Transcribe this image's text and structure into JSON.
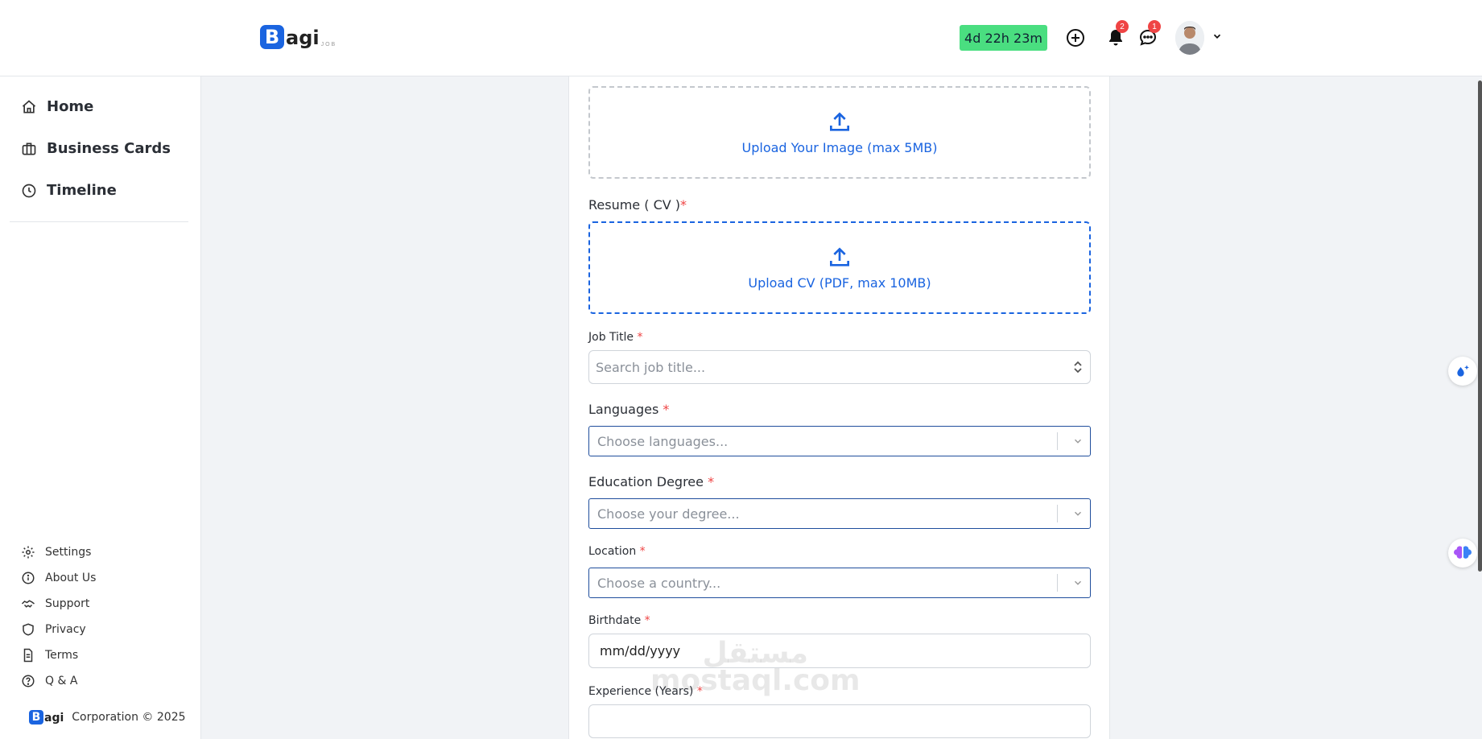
{
  "header": {
    "logo_letter": "B",
    "logo_text": "agi",
    "logo_sub": "JOB",
    "timer": "4d 22h 23m",
    "notifications_count": "2",
    "messages_count": "1"
  },
  "sidebar": {
    "nav": [
      {
        "label": "Home",
        "icon": "home-icon"
      },
      {
        "label": "Business Cards",
        "icon": "briefcase-icon"
      },
      {
        "label": "Timeline",
        "icon": "clock-icon"
      }
    ],
    "secondary": [
      {
        "label": "Settings",
        "icon": "gear-icon"
      },
      {
        "label": "About Us",
        "icon": "info-icon"
      },
      {
        "label": "Support",
        "icon": "handshake-icon"
      },
      {
        "label": "Privacy",
        "icon": "shield-icon"
      },
      {
        "label": "Terms",
        "icon": "document-icon"
      },
      {
        "label": "Q & A",
        "icon": "question-icon"
      }
    ],
    "footer_logo_letter": "B",
    "footer_logo_text": "agi",
    "footer_text": "Corporation © 2025"
  },
  "form": {
    "image_upload_text": "Upload Your Image (max 5MB)",
    "resume_label": "Resume ( CV )",
    "resume_required": "*",
    "cv_upload_text": "Upload CV (PDF, max 10MB)",
    "job_title_label": "Job Title",
    "job_title_placeholder": "Search job title...",
    "languages_label": "Languages",
    "languages_placeholder": "Choose languages...",
    "education_label": "Education Degree",
    "education_placeholder": "Choose your degree...",
    "location_label": "Location",
    "location_placeholder": "Choose a country...",
    "birthdate_label": "Birthdate",
    "birthdate_value": "mm/dd/yyyy",
    "experience_label": "Experience (Years)",
    "required_mark": "*"
  },
  "watermark": {
    "arabic": "مستقل",
    "latin": "mostaql.com"
  },
  "colors": {
    "accent": "#1a64e0",
    "timer_bg": "#4ade80",
    "badge": "#ef4444"
  }
}
